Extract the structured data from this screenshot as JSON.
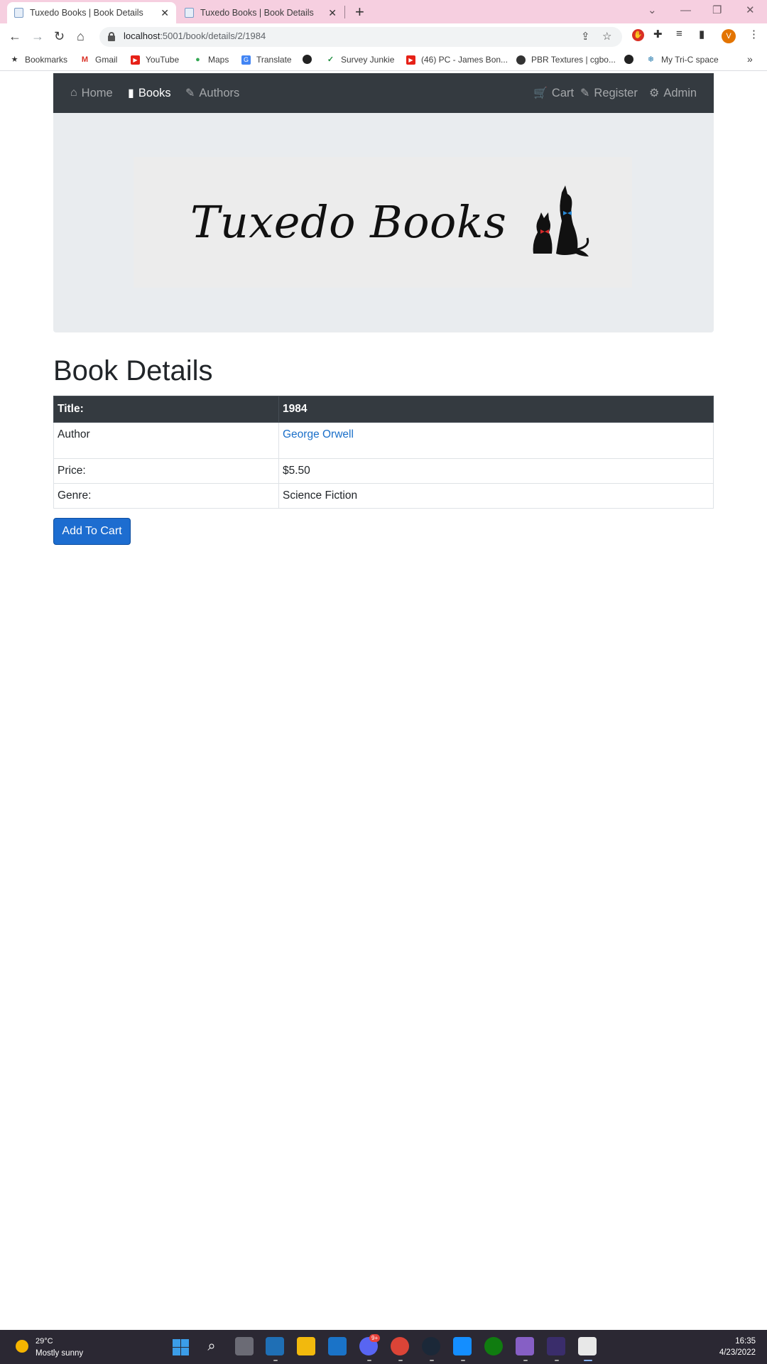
{
  "browser": {
    "tabs": [
      {
        "title": "Tuxedo Books | Book Details",
        "active": true
      },
      {
        "title": "Tuxedo Books | Book Details",
        "active": false
      }
    ],
    "new_tab_label": "+",
    "url_host": "localhost",
    "url_path": ":5001/book/details/2/1984",
    "profile_initial": "V",
    "bookmarks": [
      {
        "label": "Bookmarks",
        "icon": "star-icon"
      },
      {
        "label": "Gmail",
        "icon": "gmail-icon"
      },
      {
        "label": "YouTube",
        "icon": "youtube-icon"
      },
      {
        "label": "Maps",
        "icon": "maps-icon"
      },
      {
        "label": "Translate",
        "icon": "translate-icon"
      },
      {
        "label": "",
        "icon": "globe-icon"
      },
      {
        "label": "Survey Junkie",
        "icon": "check-icon"
      },
      {
        "label": "(46) PC - James Bon...",
        "icon": "youtube-icon"
      },
      {
        "label": "PBR Textures | cgbo...",
        "icon": "palette-icon"
      },
      {
        "label": "",
        "icon": "globe-icon"
      },
      {
        "label": "My Tri-C space",
        "icon": "snowflake-icon"
      }
    ],
    "bookmarks_overflow": "»"
  },
  "site": {
    "nav": {
      "home": "Home",
      "books": "Books",
      "authors": "Authors",
      "cart": "Cart",
      "register": "Register",
      "admin": "Admin"
    },
    "logo_text": "Tuxedo Books"
  },
  "page": {
    "title": "Book Details",
    "table": {
      "header_label": "Title:",
      "header_value": "1984",
      "author_label": "Author",
      "author_value": "George Orwell",
      "price_label": "Price:",
      "price_value": "$5.50",
      "genre_label": "Genre:",
      "genre_value": "Science Fiction"
    },
    "add_to_cart": "Add To Cart"
  },
  "taskbar": {
    "weather_temp": "29°C",
    "weather_desc": "Mostly sunny",
    "time": "16:35",
    "date": "4/23/2022",
    "discord_badge": "9+"
  },
  "colors": {
    "tabstrip": "#f6cfe0",
    "navbar": "#343a40",
    "jumbotron": "#e9ecef",
    "primary_button": "#1d6dd0",
    "link": "#1a6fc9",
    "taskbar": "#2b2833"
  }
}
